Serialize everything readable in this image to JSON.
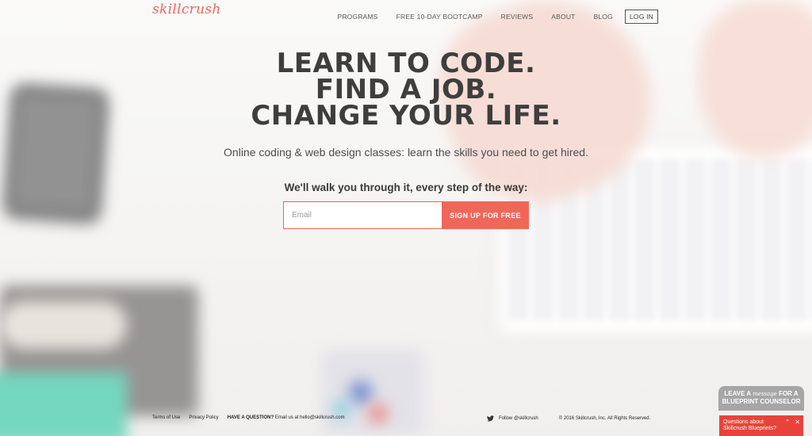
{
  "brand": {
    "logo": "skillcrush",
    "accent": "#ee6456"
  },
  "nav": {
    "items": [
      "PROGRAMS",
      "FREE 10-DAY BOOTCAMP",
      "REVIEWS",
      "ABOUT",
      "BLOG"
    ],
    "login": "LOG IN"
  },
  "hero": {
    "headline": [
      "LEARN TO CODE.",
      "FIND A JOB.",
      "CHANGE YOUR LIFE."
    ],
    "subtitle": "Online coding & web design classes: learn the skills you need to get hired.",
    "walk": "We'll walk you through it, every step of the way:",
    "email_placeholder": "Email",
    "signup_label": "SIGN UP FOR FREE"
  },
  "footer": {
    "terms": "Terms of Use",
    "privacy": "Privacy Policy",
    "question_label": "HAVE A QUESTION?",
    "question_text": "Email us at hello@skillcrush.com",
    "twitter": "Follow @skillcrush",
    "copyright": "© 2016 Skillcrush, Inc. All Rights Reserved."
  },
  "chat": {
    "top_leave": "LEAVE A",
    "top_message": "message",
    "top_for": "FOR A",
    "top_line2": "BLUEPRINT COUNSELOR",
    "bar_line1": "Questions about",
    "bar_line2": "Skillcrush Blueprints?",
    "icon_expand": "chevron-up-icon",
    "icon_close": "close-icon"
  }
}
